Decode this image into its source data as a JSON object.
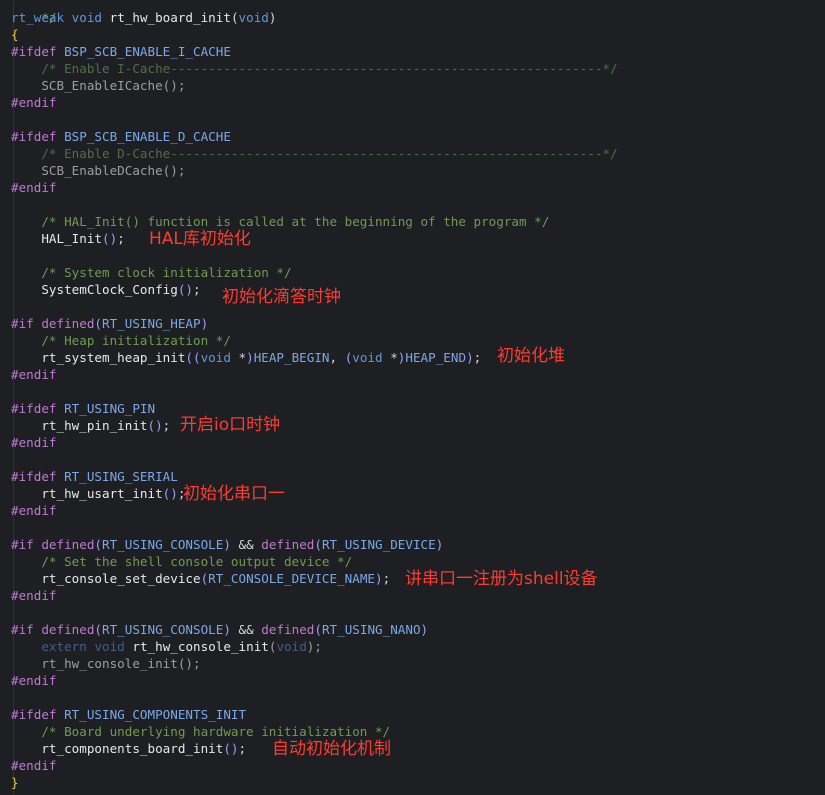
{
  "editor": {
    "code": {
      "top_comment": "*/",
      "l1": {
        "kw1": "rt_weak",
        "kw2": "void",
        "fn": "rt_hw_board_init",
        "open": "(",
        "kw3": "void",
        "close": ")"
      },
      "brace_open": "{",
      "ifdef": "#ifdef",
      "if": "#if",
      "endif": "#endif",
      "defined": "defined",
      "and": "&&",
      "icache_macro": "BSP_SCB_ENABLE_I_CACHE",
      "icache_comment": "/* Enable I-Cache---------------------------------------------------------*/",
      "icache_call": "SCB_EnableICache",
      "dcache_macro": "BSP_SCB_ENABLE_D_CACHE",
      "dcache_comment": "/* Enable D-Cache---------------------------------------------------------*/",
      "dcache_call": "SCB_EnableDCache",
      "hal_comment": "/* HAL_Init() function is called at the beginning of the program */",
      "hal_call": "HAL_Init",
      "clock_comment": "/* System clock initialization */",
      "clock_call": "SystemClock_Config",
      "heap_macro": "RT_USING_HEAP",
      "heap_comment": "/* Heap initialization */",
      "heap_call": "rt_system_heap_init",
      "heap_arg1_kw": "void",
      "heap_arg1": "HEAP_BEGIN",
      "heap_arg2_kw": "void",
      "heap_arg2": "HEAP_END",
      "pin_macro": "RT_USING_PIN",
      "pin_call": "rt_hw_pin_init",
      "serial_macro": "RT_USING_SERIAL",
      "serial_call": "rt_hw_usart_init",
      "console_macro": "RT_USING_CONSOLE",
      "device_macro": "RT_USING_DEVICE",
      "console_comment": "/* Set the shell console output device */",
      "console_call": "rt_console_set_device",
      "console_arg": "RT_CONSOLE_DEVICE_NAME",
      "nano_macro": "RT_USING_NANO",
      "nano_extern": "extern",
      "nano_void1": "void",
      "nano_fn1": "rt_hw_console_init",
      "nano_void2": "void",
      "nano_fn2": "rt_hw_console_init",
      "components_macro": "RT_USING_COMPONENTS_INIT",
      "components_comment": "/* Board underlying hardware initialization */",
      "components_call": "rt_components_board_init",
      "brace_close": "}"
    },
    "annotations": {
      "hal": "HAL库初始化",
      "clock": "初始化滴答时钟",
      "heap": "初始化堆",
      "pin": "开启io口时钟",
      "serial": "初始化串口一",
      "console": "讲串口一注册为shell设备",
      "components": "自动初始化机制"
    }
  },
  "colors": {
    "background": "#1e1f22",
    "annotation": "#ff3b2f",
    "keyword": "#5f97d8",
    "preprocessor": "#bf79d4",
    "macro": "#7aa8e8",
    "comment": "#6e9b52",
    "brace": "#e6c84a"
  }
}
